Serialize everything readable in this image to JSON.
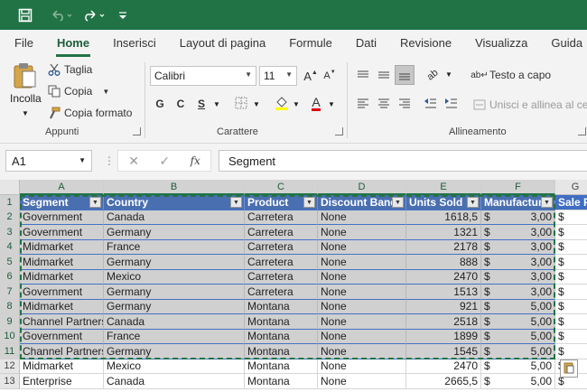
{
  "titlebar": {
    "icons": [
      "save-icon",
      "undo-icon",
      "redo-icon",
      "customize-icon"
    ]
  },
  "menu": {
    "tabs": [
      "File",
      "Home",
      "Inserisci",
      "Layout di pagina",
      "Formule",
      "Dati",
      "Revisione",
      "Visualizza",
      "Guida"
    ],
    "active": "Home"
  },
  "ribbon": {
    "clipboard": {
      "paste_label": "Incolla",
      "cut_label": "Taglia",
      "copy_label": "Copia",
      "format_painter_label": "Copia formato",
      "group_label": "Appunti"
    },
    "font": {
      "font_name": "Calibri",
      "font_size": "11",
      "bold": "G",
      "italic": "C",
      "underline": "S",
      "font_color_letter": "A",
      "grow_letter": "A",
      "shrink_letter": "A",
      "group_label": "Carattere"
    },
    "alignment": {
      "wrap_text_label": "Testo a capo",
      "merge_label": "Unisci e allinea al cen",
      "group_label": "Allineamento"
    }
  },
  "formula_bar": {
    "name_box": "A1",
    "fx": "fx",
    "content": "Segment"
  },
  "sheet": {
    "columns": [
      "A",
      "B",
      "C",
      "D",
      "E",
      "F",
      "G"
    ],
    "header_row": [
      "Segment",
      "Country",
      "Product",
      "Discount Band",
      "Units Sold",
      "Manufacturi",
      "Sale P"
    ],
    "row_numbers": [
      "1",
      "2",
      "3",
      "4",
      "5",
      "6",
      "7",
      "8",
      "9",
      "10",
      "11",
      "12",
      "13"
    ],
    "rows": [
      [
        "Government",
        "Canada",
        "Carretera",
        "None",
        "1618,5",
        "$",
        "3,00",
        "$"
      ],
      [
        "Government",
        "Germany",
        "Carretera",
        "None",
        "1321",
        "$",
        "3,00",
        "$"
      ],
      [
        "Midmarket",
        "France",
        "Carretera",
        "None",
        "2178",
        "$",
        "3,00",
        "$"
      ],
      [
        "Midmarket",
        "Germany",
        "Carretera",
        "None",
        "888",
        "$",
        "3,00",
        "$"
      ],
      [
        "Midmarket",
        "Mexico",
        "Carretera",
        "None",
        "2470",
        "$",
        "3,00",
        "$"
      ],
      [
        "Government",
        "Germany",
        "Carretera",
        "None",
        "1513",
        "$",
        "3,00",
        "$"
      ],
      [
        "Midmarket",
        "Germany",
        "Montana",
        "None",
        "921",
        "$",
        "5,00",
        "$"
      ],
      [
        "Channel Partners",
        "Canada",
        "Montana",
        "None",
        "2518",
        "$",
        "5,00",
        "$"
      ],
      [
        "Government",
        "France",
        "Montana",
        "None",
        "1899",
        "$",
        "5,00",
        "$"
      ],
      [
        "Channel Partners",
        "Germany",
        "Montana",
        "None",
        "1545",
        "$",
        "5,00",
        "$"
      ],
      [
        "Midmarket",
        "Mexico",
        "Montana",
        "None",
        "2470",
        "$",
        "5,00",
        "$"
      ],
      [
        "Enterprise",
        "Canada",
        "Montana",
        "None",
        "2665,5",
        "$",
        "5,00",
        "$"
      ]
    ],
    "selected_rows": 11
  },
  "colors": {
    "brand": "#217346",
    "table_header": "#4472c4",
    "selection": "#d0d0d0"
  }
}
